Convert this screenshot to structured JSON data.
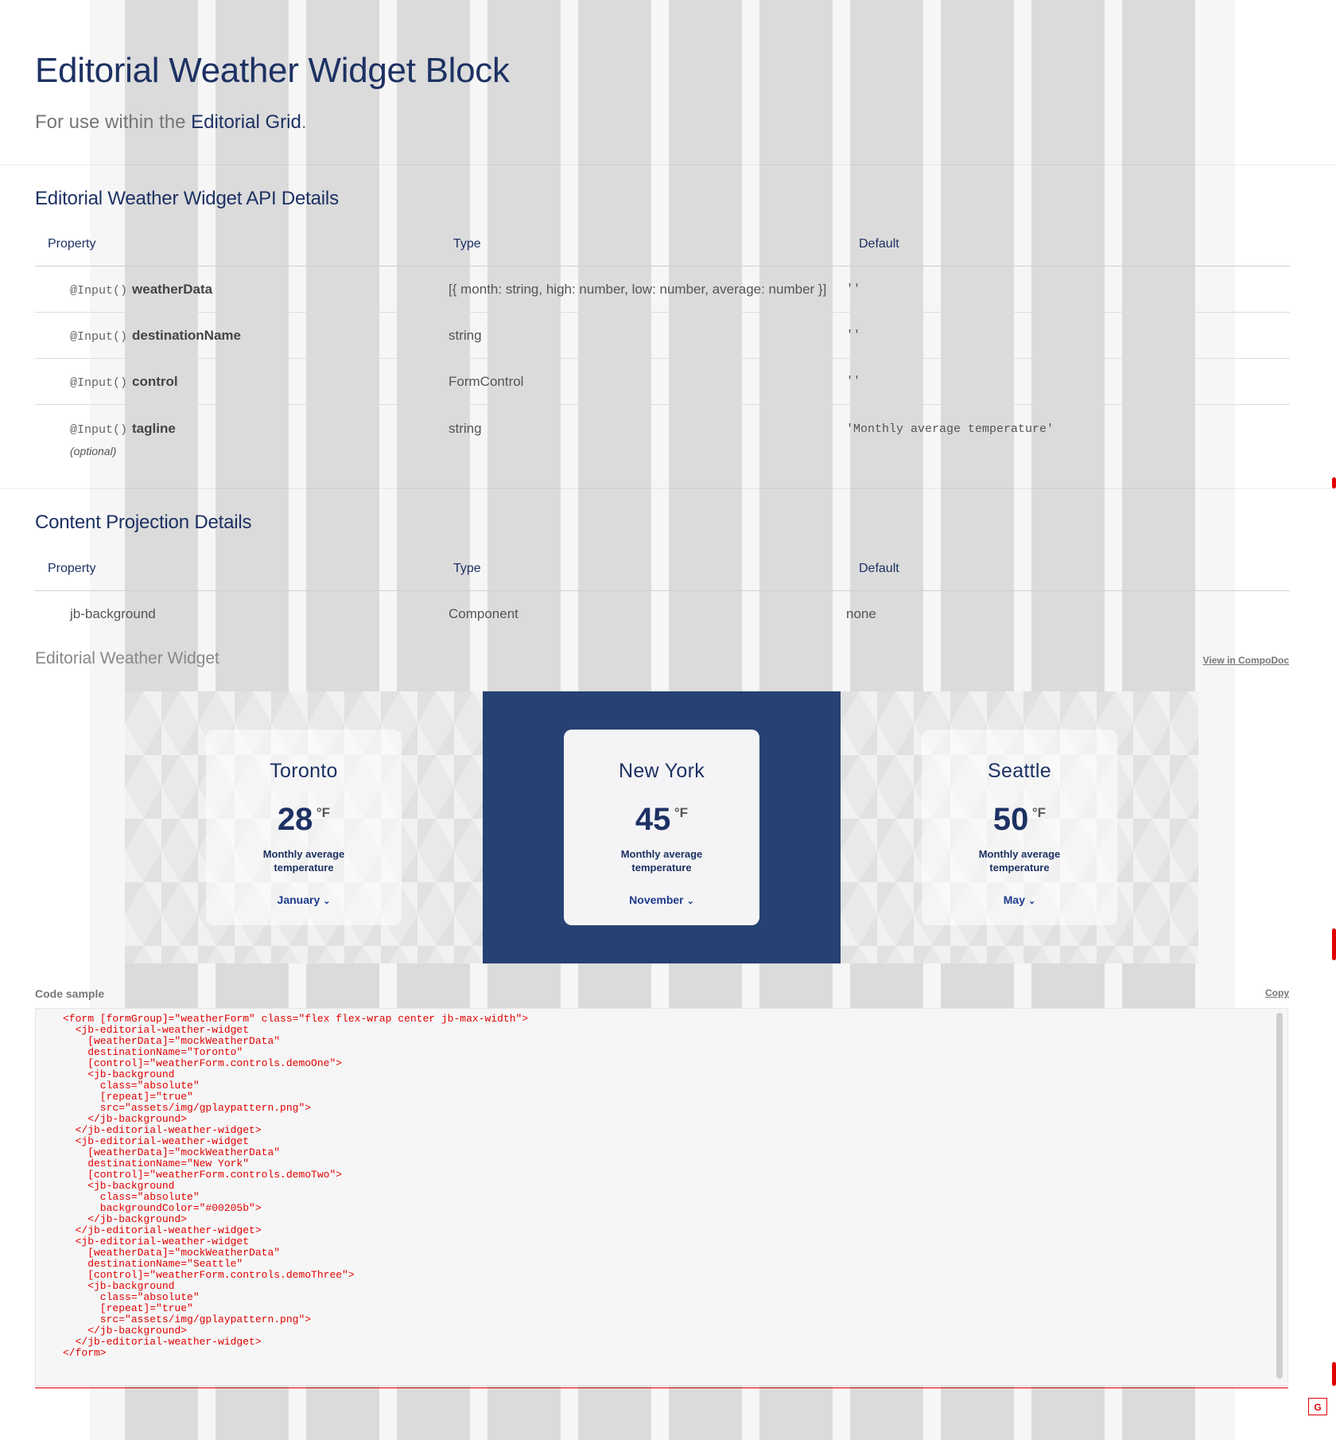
{
  "hero": {
    "title": "Editorial Weather Widget Block",
    "subtitle_prefix": "For use within the ",
    "subtitle_link": "Editorial Grid",
    "subtitle_suffix": "."
  },
  "api": {
    "title": "Editorial Weather Widget API Details",
    "headers": [
      "Property",
      "Type",
      "Default"
    ],
    "rows": [
      {
        "decorator": "@Input()",
        "name": "weatherData",
        "optional": "",
        "type": "[{ month: string, high: number, low: number, average: number }]",
        "default": "''"
      },
      {
        "decorator": "@Input()",
        "name": "destinationName",
        "optional": "",
        "type": "string",
        "default": "''"
      },
      {
        "decorator": "@Input()",
        "name": "control",
        "optional": "",
        "type": "FormControl",
        "default": "''"
      },
      {
        "decorator": "@Input()",
        "name": "tagline",
        "optional": "(optional)",
        "type": "string",
        "default": "'Monthly average temperature'"
      }
    ]
  },
  "projection": {
    "title": "Content Projection Details",
    "headers": [
      "Property",
      "Type",
      "Default"
    ],
    "rows": [
      {
        "property": "jb-background",
        "type": "Component",
        "default": "none"
      }
    ]
  },
  "demo": {
    "title": "Editorial Weather Widget",
    "compodoc_link": "View in CompoDoc",
    "widgets": [
      {
        "city": "Toronto",
        "temp": "28",
        "unit": "°F",
        "tagline": "Monthly average temperature",
        "month": "January",
        "background": "pattern"
      },
      {
        "city": "New York",
        "temp": "45",
        "unit": "°F",
        "tagline": "Monthly average temperature",
        "month": "November",
        "background": "#00205b"
      },
      {
        "city": "Seattle",
        "temp": "50",
        "unit": "°F",
        "tagline": "Monthly average temperature",
        "month": "May",
        "background": "pattern"
      }
    ]
  },
  "code": {
    "label": "Code sample",
    "copy_label": "Copy",
    "sample": "<form [formGroup]=\"weatherForm\" class=\"flex flex-wrap center jb-max-width\">\n  <jb-editorial-weather-widget\n    [weatherData]=\"mockWeatherData\"\n    destinationName=\"Toronto\"\n    [control]=\"weatherForm.controls.demoOne\">\n    <jb-background\n      class=\"absolute\"\n      [repeat]=\"true\"\n      src=\"assets/img/gplaypattern.png\">\n    </jb-background>\n  </jb-editorial-weather-widget>\n  <jb-editorial-weather-widget\n    [weatherData]=\"mockWeatherData\"\n    destinationName=\"New York\"\n    [control]=\"weatherForm.controls.demoTwo\">\n    <jb-background\n      class=\"absolute\"\n      backgroundColor=\"#00205b\">\n    </jb-background>\n  </jb-editorial-weather-widget>\n  <jb-editorial-weather-widget\n    [weatherData]=\"mockWeatherData\"\n    destinationName=\"Seattle\"\n    [control]=\"weatherForm.controls.demoThree\">\n    <jb-background\n      class=\"absolute\"\n      [repeat]=\"true\"\n      src=\"assets/img/gplaypattern.png\">\n    </jb-background>\n  </jb-editorial-weather-widget>\n</form>"
  },
  "badge": "G",
  "colors": {
    "brand_navy": "#1d3163",
    "brand_blue": "#00205b",
    "accent_red": "#ff0000"
  }
}
